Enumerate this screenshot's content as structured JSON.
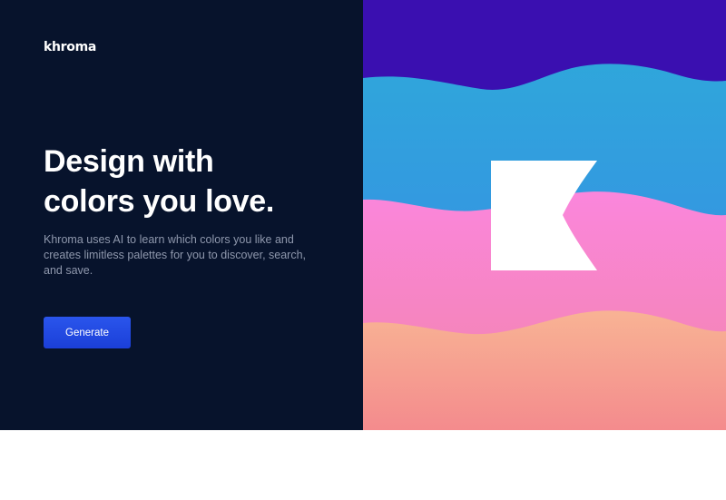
{
  "brand": {
    "logo_text": "khroma"
  },
  "hero": {
    "headline_line1": "Design with",
    "headline_line2": "colors you love.",
    "description": "Khroma uses AI to learn which colors you like and creates limitless palettes for you to discover, search, and save.",
    "generate_label": "Generate"
  },
  "illustration": {
    "icon_name": "khroma-k-logo-icon",
    "colors": {
      "top_band": "#3a0fb0",
      "blue_band_top": "#2fa6db",
      "blue_band_bottom": "#3a86e8",
      "pink_band_top": "#fb86dc",
      "pink_band_bottom": "#f184a8",
      "peach_band_top": "#f8b394",
      "peach_band_bottom": "#f48b8d",
      "logo_fill": "#ffffff"
    }
  },
  "theme": {
    "left_panel_bg": "#07132c",
    "accent": "#2347e3"
  }
}
